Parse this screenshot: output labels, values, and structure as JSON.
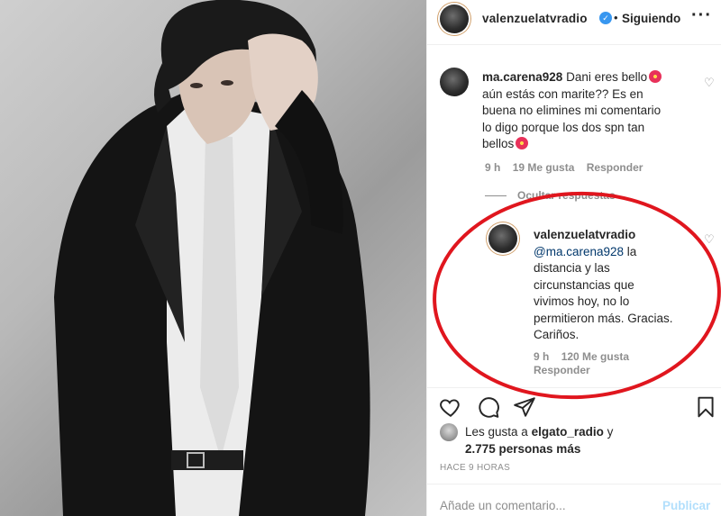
{
  "post": {
    "author": "valenzuelatvradio",
    "follow_state": "Siguiendo",
    "separator": "•",
    "more": "···",
    "verified_mark": "✓"
  },
  "comment": {
    "username": "ma.carena928",
    "text_lines": [
      "Dani eres bello",
      "aún estás con marite?? Es en",
      "buena no elimines mi comentario",
      "lo digo porque los dos spn tan",
      "bellos"
    ],
    "time": "9 h",
    "likes": "19 Me gusta",
    "reply": "Responder",
    "hide_replies": "Ocultar respuestas"
  },
  "reply": {
    "username": "valenzuelatvradio",
    "mention": "@ma.carena928",
    "text_lines": [
      "la",
      "distancia y las",
      "circunstancias que",
      "vivimos hoy, no lo",
      "permitieron más. Gracias.",
      "Cariños."
    ],
    "time": "9 h",
    "likes": "120 Me gusta",
    "reply": "Responder"
  },
  "likes": {
    "prefix": "Les gusta a",
    "user": "elgato_radio",
    "connector": "y",
    "count": "2.775 personas más"
  },
  "time_ago": "HACE 9 HORAS",
  "add_comment": {
    "placeholder": "Añade un comentario...",
    "post_label": "Publicar"
  },
  "icons": {
    "more": "more-icon",
    "heart": "heart-icon",
    "comment": "comment-icon",
    "share": "share-icon",
    "save": "bookmark-icon",
    "verified": "verified-badge-icon",
    "emoji": "flower-emoji-icon"
  },
  "colors": {
    "text": "#262626",
    "muted": "#8e8e8e",
    "link": "#00376b",
    "verified": "#3897f0",
    "post_button_disabled": "#b2dffc",
    "annotation": "#e0161e"
  }
}
